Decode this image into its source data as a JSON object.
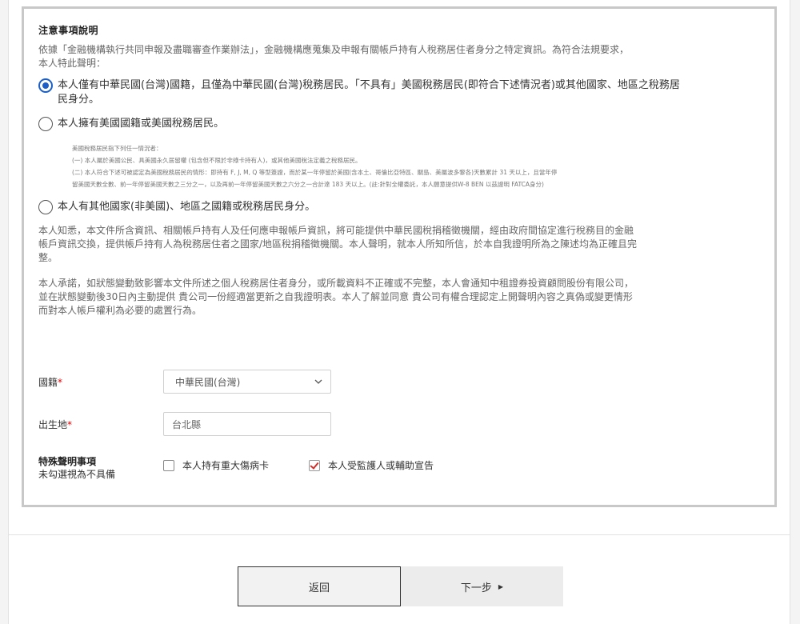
{
  "notice": {
    "title": "注意事項說明",
    "intro_line1": "依據「金融機構執行共同申報及盡職審查作業辦法」，金融機構應蒐集及申報有關帳戶持有人稅務居住者身分之特定資訊。為符合法規要求，",
    "intro_line2": "本人特此聲明："
  },
  "options": [
    {
      "line1": "本人僅有中華民國(台灣)國籍，且僅為中華民國(台灣)稅務居民。「不具有」美國稅務居民(即符合下述情況者)或其他國家、地區之稅務居",
      "line2": "民身分。",
      "checked": true
    },
    {
      "line1": "本人擁有美國國籍或美國稅務居民。",
      "checked": false
    },
    {
      "line1": "本人有其他國家(非美國)、地區之國籍或稅務居民身分。",
      "checked": false
    }
  ],
  "us_definition": {
    "line1": "美國稅務居民指下列任一情況者：",
    "line2": "(一) 本人屬於美國公民、具美國永久居留權 (包含但不限於非綠卡持有人)，或其他美國稅法定義之稅務居民。",
    "line3": "(二) 本人符合下述可被認定為美國稅務居民的情形：即持有 F, J, M, Q 等型簽證，而於某一年停留於美國(含本土、哥倫比亞特區、關島、美屬波多黎各)天數累計 31 天以上，且當年停",
    "line4": "留美國天數全數、前一年停留美國天數之三分之一，以及再前一年停留美國天數之六分之一合計達 183 天以上。(註:針對全權委託，本人願意提供W-8 BEN 以茲證明 FATCA身分)"
  },
  "acknowledgement": {
    "line1": "本人知悉，本文件所含資訊、相關帳戶持有人及任何應申報帳戶資訊，將可能提供中華民國稅捐稽徵機關，經由政府間協定進行稅務目的金融",
    "line2": "帳戶資訊交換，提供帳戶持有人為稅務居住者之國家/地區稅捐稽徵機關。本人聲明，就本人所知所信，於本自我證明所為之陳述均為正確且完",
    "line3": "整。"
  },
  "commitment": {
    "line1": "本人承諾，如狀態變動致影響本文件所述之個人稅務居住者身分，或所載資料不正確或不完整，本人會通知中租證券投資顧問股份有限公司，",
    "line2": "並在狀態變動後30日內主動提供 貴公司一份經適當更新之自我證明表。本人了解並同意 貴公司有權合理認定上開聲明內容之真偽或變更情形",
    "line3": "而對本人帳戶權利為必要的處置行為。"
  },
  "form": {
    "nationality_label": "國籍",
    "nationality_value": "中華民國(台灣)",
    "birthplace_label": "出生地",
    "birthplace_placeholder": "台北縣",
    "required_mark": "*",
    "special_label": "特殊聲明事項",
    "special_sub": "未勾選視為不具備",
    "checkbox1_label": "本人持有重大傷病卡",
    "checkbox1_checked": false,
    "checkbox2_label": "本人受監護人或輔助宣告",
    "checkbox2_checked": true
  },
  "buttons": {
    "back": "返回",
    "next": "下一步"
  }
}
